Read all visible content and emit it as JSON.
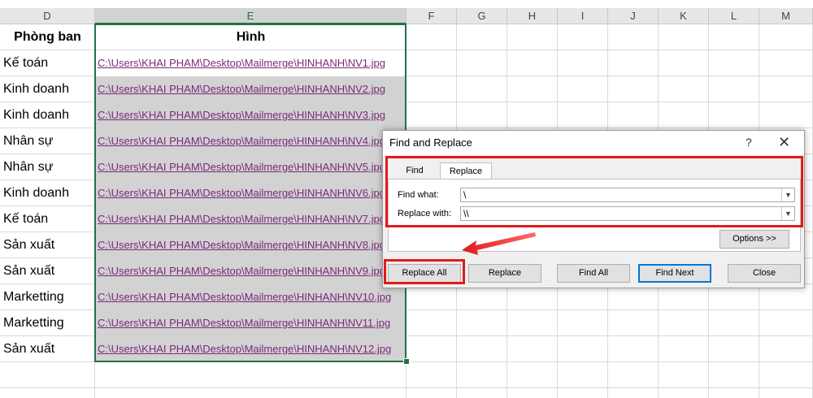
{
  "columns": [
    "D",
    "E",
    "F",
    "G",
    "H",
    "I",
    "J",
    "K",
    "L",
    "M"
  ],
  "header_row": {
    "phong_ban": "Phòng ban",
    "hinh": "Hình"
  },
  "rows": [
    {
      "dept": "Kế toán",
      "path": "C:\\Users\\KHAI PHAM\\Desktop\\Mailmerge\\HINHANH\\NV1.jpg"
    },
    {
      "dept": "Kinh doanh",
      "path": "C:\\Users\\KHAI PHAM\\Desktop\\Mailmerge\\HINHANH\\NV2.jpg"
    },
    {
      "dept": "Kinh doanh",
      "path": "C:\\Users\\KHAI PHAM\\Desktop\\Mailmerge\\HINHANH\\NV3.jpg"
    },
    {
      "dept": "Nhân sự",
      "path": "C:\\Users\\KHAI PHAM\\Desktop\\Mailmerge\\HINHANH\\NV4.jpg"
    },
    {
      "dept": "Nhân sự",
      "path": "C:\\Users\\KHAI PHAM\\Desktop\\Mailmerge\\HINHANH\\NV5.jpg"
    },
    {
      "dept": "Kinh doanh",
      "path": "C:\\Users\\KHAI PHAM\\Desktop\\Mailmerge\\HINHANH\\NV6.jpg"
    },
    {
      "dept": "Kế toán",
      "path": "C:\\Users\\KHAI PHAM\\Desktop\\Mailmerge\\HINHANH\\NV7.jpg"
    },
    {
      "dept": "Sản xuất",
      "path": "C:\\Users\\KHAI PHAM\\Desktop\\Mailmerge\\HINHANH\\NV8.jpg"
    },
    {
      "dept": "Sản xuất",
      "path": "C:\\Users\\KHAI PHAM\\Desktop\\Mailmerge\\HINHANH\\NV9.jpg"
    },
    {
      "dept": "Marketting",
      "path": "C:\\Users\\KHAI PHAM\\Desktop\\Mailmerge\\HINHANH\\NV10.jpg"
    },
    {
      "dept": "Marketting",
      "path": "C:\\Users\\KHAI PHAM\\Desktop\\Mailmerge\\HINHANH\\NV11.jpg"
    },
    {
      "dept": "Sản xuất",
      "path": "C:\\Users\\KHAI PHAM\\Desktop\\Mailmerge\\HINHANH\\NV12.jpg"
    }
  ],
  "dialog": {
    "title": "Find and Replace",
    "help": "?",
    "close": "✕",
    "tabs": {
      "find": "Find",
      "replace": "Replace"
    },
    "find_what_label": "Find what:",
    "find_what_value": "\\",
    "replace_with_label": "Replace with:",
    "replace_with_value": "\\\\",
    "options_button": "Options >>",
    "buttons": {
      "replace_all": "Replace All",
      "replace": "Replace",
      "find_all": "Find All",
      "find_next": "Find Next",
      "close": "Close"
    }
  },
  "colors": {
    "selection_green": "#217346",
    "annotation_red": "#e01b1b",
    "hyperlink": "#7a2a7a"
  }
}
